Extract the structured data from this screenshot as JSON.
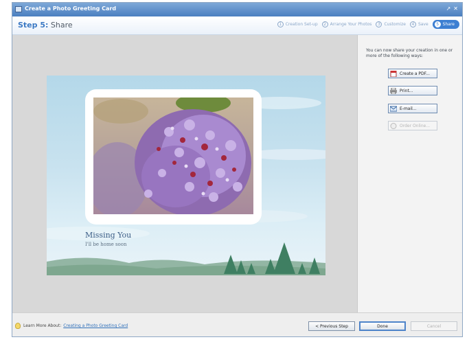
{
  "window": {
    "title": "Create a Photo Greeting Card",
    "controls": [
      "↗",
      "✕"
    ]
  },
  "header": {
    "step_number": "Step 5:",
    "step_name": "Share",
    "steps": [
      {
        "num": "1",
        "label": "Creation Set-up"
      },
      {
        "num": "2",
        "label": "Arrange Your Photos"
      },
      {
        "num": "3",
        "label": "Customize"
      },
      {
        "num": "4",
        "label": "Save"
      },
      {
        "num": "5",
        "label": "Share"
      }
    ]
  },
  "card": {
    "caption_title": "Missing You",
    "caption_subtitle": "I'll be home soon"
  },
  "share_panel": {
    "intro": "You can now share your creation in one or more of the following ways:",
    "options": [
      {
        "label": "Create a PDF...",
        "icon": "pdf-icon",
        "enabled": true
      },
      {
        "label": "Print...",
        "icon": "printer-icon",
        "enabled": true
      },
      {
        "label": "E-mail...",
        "icon": "email-icon",
        "enabled": true
      },
      {
        "label": "Order Online...",
        "icon": "globe-icon",
        "enabled": false
      }
    ]
  },
  "footer": {
    "learn_label": "Learn More About:",
    "learn_link": "Creating a Photo Greeting Card",
    "previous_label": "< Previous Step",
    "done_label": "Done",
    "cancel_label": "Cancel"
  },
  "colors": {
    "accent": "#3d7fd2",
    "title_bar": "#5a8dcb",
    "link": "#2f6fb9"
  }
}
